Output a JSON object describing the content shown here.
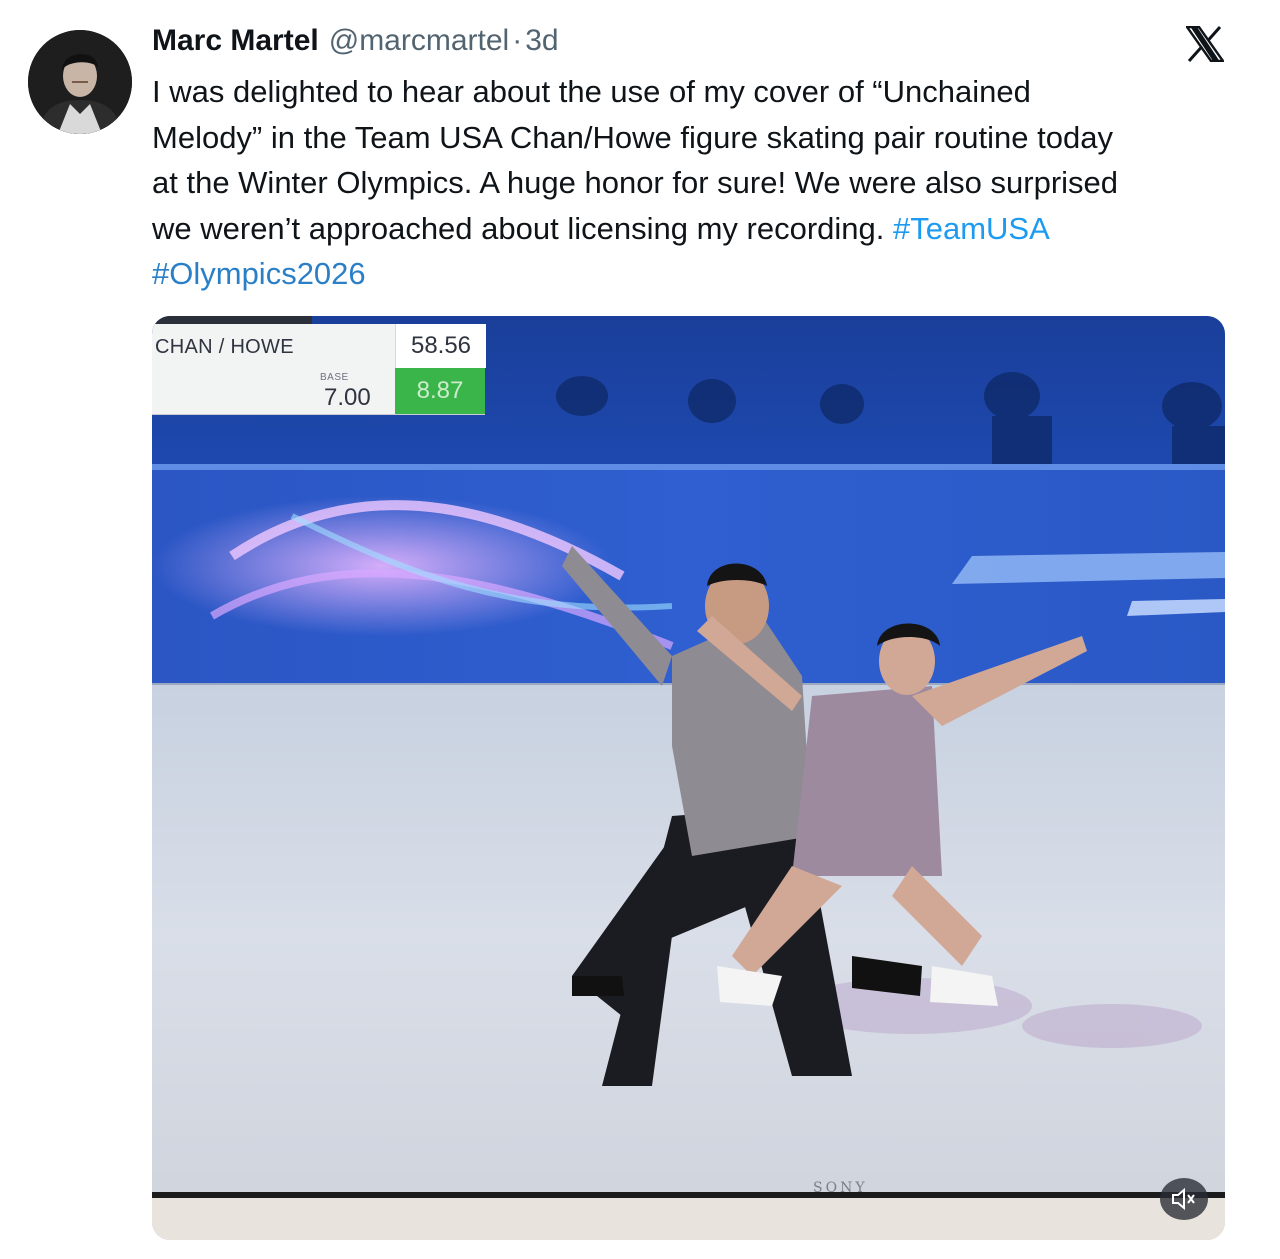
{
  "author": {
    "name": "Marc Martel",
    "handle": "@marcmartel",
    "separator": "·",
    "age": "3d"
  },
  "tweet": {
    "lines": [
      "I was delighted to hear about the use of my cover of “Unchained",
      "Melody” in the Team USA Chan/Howe figure skating pair routine today",
      "at the Winter Olympics. A huge honor for sure!  We were also surprised",
      "we weren’t approached about licensing my recording. "
    ],
    "hashtags": [
      "#TeamUSA",
      "#Olympics2026"
    ]
  },
  "media": {
    "scoreboard": {
      "team": "CHAN / HOWE",
      "total": "58.56",
      "base_label": "BASE",
      "base_value": "7.00",
      "goe_value": "8.87"
    },
    "tv_brand": "SONY"
  },
  "icons": {
    "platform": "x-logo-icon",
    "mute": "volume-muted-icon"
  },
  "colors": {
    "hashtag": "#1d9bf0",
    "score_green": "#3ab54a",
    "secondary_text": "#536471"
  }
}
